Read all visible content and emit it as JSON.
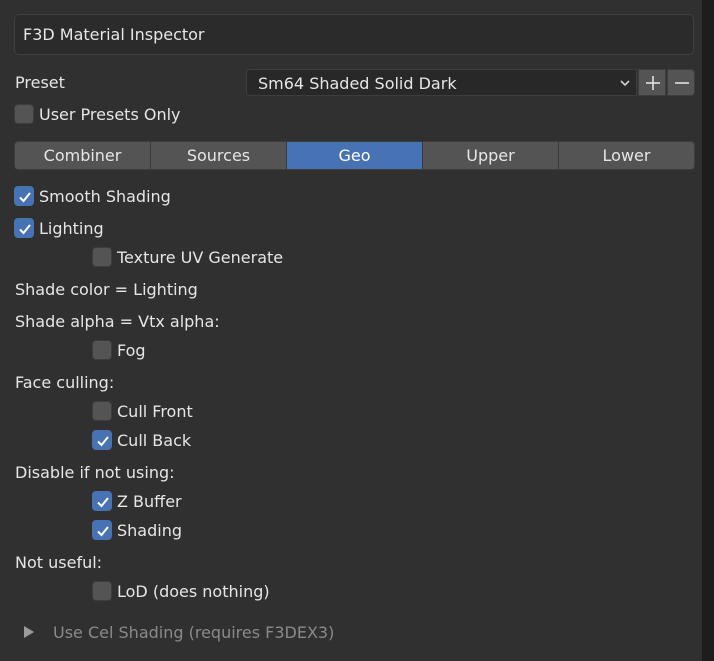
{
  "header": {
    "title": "F3D Material Inspector"
  },
  "preset": {
    "label": "Preset",
    "value": "Sm64 Shaded Solid Dark",
    "add_icon": "plus-icon",
    "remove_icon": "minus-icon"
  },
  "user_presets_only": {
    "label": "User Presets Only",
    "checked": false
  },
  "tabs": [
    {
      "label": "Combiner",
      "active": false
    },
    {
      "label": "Sources",
      "active": false
    },
    {
      "label": "Geo",
      "active": true
    },
    {
      "label": "Upper",
      "active": false
    },
    {
      "label": "Lower",
      "active": false
    }
  ],
  "geo": {
    "smooth_shading": {
      "label": "Smooth Shading",
      "checked": true
    },
    "lighting": {
      "label": "Lighting",
      "checked": true
    },
    "texture_uv_generate": {
      "label": "Texture UV Generate",
      "checked": false
    },
    "shade_color_text": "Shade color = Lighting",
    "shade_alpha_text": "Shade alpha = Vtx alpha:",
    "fog": {
      "label": "Fog",
      "checked": false
    },
    "face_culling_heading": "Face culling:",
    "cull_front": {
      "label": "Cull Front",
      "checked": false
    },
    "cull_back": {
      "label": "Cull Back",
      "checked": true
    },
    "disable_heading": "Disable if not using:",
    "z_buffer": {
      "label": "Z Buffer",
      "checked": true
    },
    "shading": {
      "label": "Shading",
      "checked": true
    },
    "not_useful_heading": "Not useful:",
    "lod": {
      "label": "LoD (does nothing)",
      "checked": false
    },
    "cel_shading_label": "Use Cel Shading (requires F3DEX3)"
  },
  "colors": {
    "background": "#303030",
    "accent": "#4772b3",
    "text": "#e6e6e6"
  }
}
